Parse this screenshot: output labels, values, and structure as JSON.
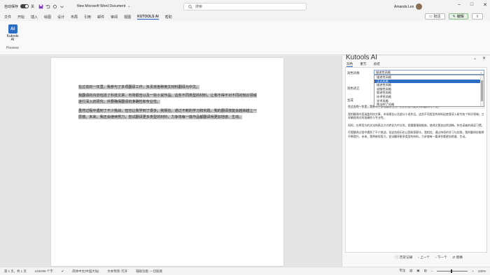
{
  "titlebar": {
    "autosave_label": "自动保存",
    "autosave_state": "关",
    "doc_title": "New Microsoft Word Document",
    "search_placeholder": "搜索",
    "user_name": "Amanda Lee"
  },
  "menu": {
    "items": [
      "文件",
      "开始",
      "插入",
      "绘图",
      "设计",
      "布局",
      "引用",
      "邮件",
      "审阅",
      "视图",
      "KUTOOLS AI",
      "帮助"
    ],
    "active_index": 10,
    "comment_btn": "批注",
    "edit_btn": "编辑"
  },
  "ribbon": {
    "kutools_btn": "Kutools AI",
    "icon_text": "AI",
    "group_label": "Preview"
  },
  "document": {
    "paragraphs": [
      "在过去的一年里，我参与了多项翻译工作，负责将各种英文材料翻译为中文。",
      "我翻译的内容包括了科技文章、市场报告以及一些小说作品。这些不同类型的材料，让我不得不对不同的知识领域进行深入的研究，并要确保翻译的准确性和专业性。",
      "虽然过程中遇到了不少挑战，但也让我学到了很多。我相信，通过不断的学习和实践，我的翻译技能会越来越上一层楼。未来，我还会继续努力，尝试翻译更多类型的材料，力争将每一篇作品都翻译得更加地道、生动。"
    ]
  },
  "pane": {
    "title": "Kutools AI",
    "tabs": [
      "润色",
      "重写",
      "总结"
    ],
    "style_label": "润色风格",
    "style_value": "描述性风格",
    "style_options": [
      "描述性风格",
      "正式风格",
      "描述性风格",
      "说服性风格",
      "叙述性风格",
      "技术性风格",
      "学术风格",
      "简洁明了风格"
    ],
    "selected_option_index": 1,
    "lang_label": "润色语言",
    "gen_label": "生成",
    "ai_paragraphs": [
      "在过去的一年里，我参与了多项翻译工作，负责将各种英文材料翻译为中文。",
      "我的翻译内容涵盖科技文章、市场报告以及部分小说作品。这些不同类型的材料促使我深入研究各个知识领域，力求确保译文的准确性与专业性。",
      "同时，在将西方的文化和表达方式转化为中文时，我需要细致推敲，使译文更加自然流畅，符合读者的阅读习惯。",
      "尽管翻译过程中遇到了不少挑战，但这些经历也让我收获颇丰。我相信，通过持续的学习与实践，我的翻译技能将不断提升。未来，我将继续努力，尝试翻译更多类型的材料，力求使每一篇译作都更加地道、生动。"
    ],
    "footer": [
      "历史记录",
      "上一个",
      "下一个",
      "替换"
    ]
  },
  "status": {
    "page": "第 1 页，共 1 页",
    "words": "219/259 个字",
    "lang": "简体中文(中国大陆)",
    "predict": "文本预测: 打开",
    "access": "辅助功能: 一切就绪",
    "focus": "专注",
    "zoom": "100%"
  },
  "colors": {
    "accent": "#2b6cc4",
    "highlight": "#c9c9c9"
  }
}
